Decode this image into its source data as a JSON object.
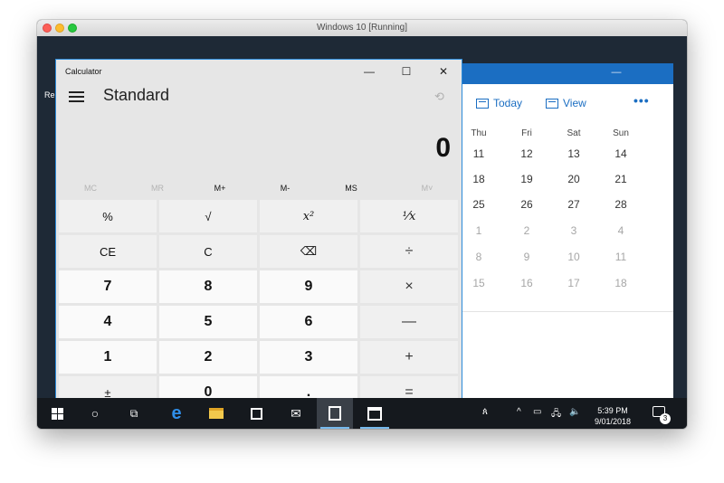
{
  "host": {
    "title": "Windows 10 [Running]"
  },
  "desktop": {
    "partial_label": "Re"
  },
  "calculator": {
    "title": "Calculator",
    "mode": "Standard",
    "display": "0",
    "controls": {
      "minimize": "—",
      "maximize": "☐",
      "close": "✕"
    },
    "history_icon": "history-icon",
    "memory": [
      "MC",
      "MR",
      "M+",
      "M-",
      "MS",
      "M˅"
    ],
    "keys": [
      [
        "%",
        "√",
        "x²",
        "¹⁄x"
      ],
      [
        "CE",
        "C",
        "⌫",
        "÷"
      ],
      [
        "7",
        "8",
        "9",
        "×"
      ],
      [
        "4",
        "5",
        "6",
        "—"
      ],
      [
        "1",
        "2",
        "3",
        "+"
      ],
      [
        "±",
        "0",
        ".",
        "="
      ]
    ]
  },
  "calendar": {
    "controls": {
      "minimize": "—",
      "maximize": "☐",
      "close": "✕"
    },
    "toolbar": {
      "today": "Today",
      "view": "View",
      "more": "•••"
    },
    "weekdays": [
      "Thu",
      "Fri",
      "Sat",
      "Sun"
    ],
    "weeks": [
      [
        "11",
        "12",
        "13",
        "14"
      ],
      [
        "18",
        "19",
        "20",
        "21"
      ],
      [
        "25",
        "26",
        "27",
        "28"
      ],
      [
        "1",
        "2",
        "3",
        "4"
      ],
      [
        "8",
        "9",
        "10",
        "11"
      ],
      [
        "15",
        "16",
        "17",
        "18"
      ]
    ]
  },
  "taskbar": {
    "clock_time": "5:39 PM",
    "clock_date": "9/01/2018",
    "notification_count": "3",
    "people_label": "ጰ",
    "tray_chevron": "^"
  },
  "colors": {
    "accent": "#1b6ec2",
    "calc_border": "#2b8ad9",
    "taskbar": "#15191e"
  }
}
